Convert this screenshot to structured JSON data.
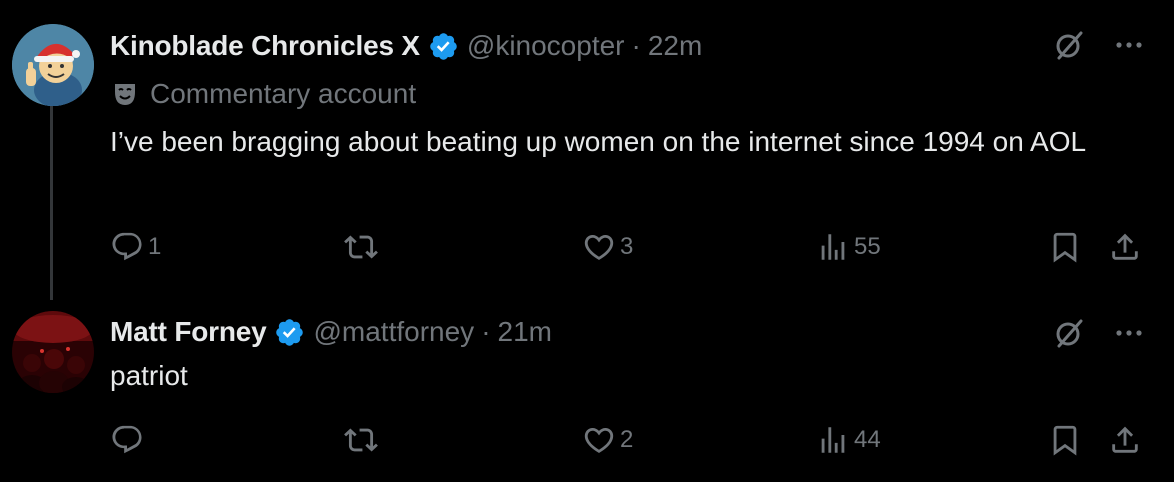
{
  "tweets": [
    {
      "display_name": "Kinoblade Chronicles X",
      "handle": "@kinocopter",
      "separator": "·",
      "time": "22m",
      "commentary_label": "Commentary account",
      "text": "I’ve been bragging about beating up women on the internet since 1994 on AOL",
      "reply_count": "1",
      "retweet_count": "",
      "like_count": "3",
      "view_count": "55",
      "avatar_icon": "vault-boy-santa-avatar"
    },
    {
      "display_name": "Matt Forney",
      "handle": "@mattforney",
      "separator": "·",
      "time": "21m",
      "text": "patriot",
      "reply_count": "",
      "retweet_count": "",
      "like_count": "2",
      "view_count": "44",
      "avatar_icon": "red-crowd-photo-avatar"
    }
  ],
  "colors": {
    "background": "#000000",
    "primary_text": "#e7e9ea",
    "secondary_text": "#71767b",
    "verified_blue": "#1d9bf0",
    "thread_line": "#333639"
  }
}
